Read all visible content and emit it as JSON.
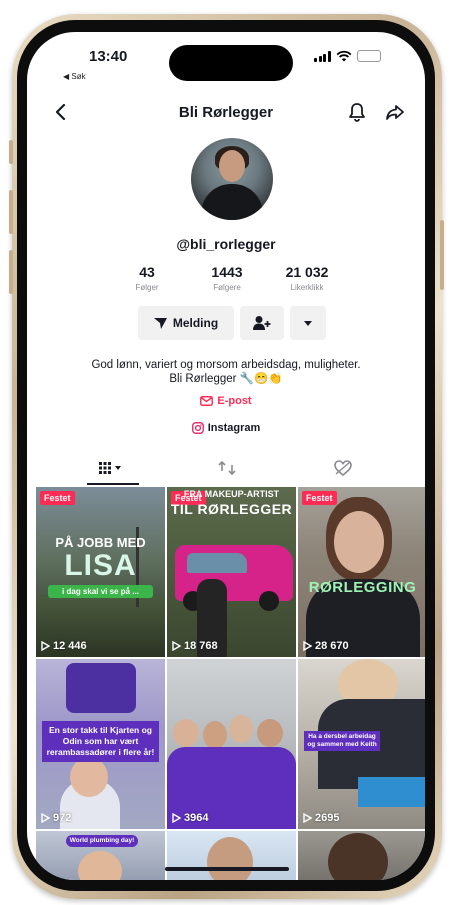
{
  "status_bar": {
    "time": "13:40",
    "back_label": "◀ Søk"
  },
  "header": {
    "title": "Bli Rørlegger"
  },
  "profile": {
    "handle": "@bli_rorlegger",
    "stats": [
      {
        "value": "43",
        "label": "Følger"
      },
      {
        "value": "1443",
        "label": "Følgere"
      },
      {
        "value": "21 032",
        "label": "Likerklikk"
      }
    ],
    "message_button": "Melding",
    "bio_line1": "God lønn, variert og morsom arbeidsdag, muligheter.",
    "bio_line2": "Bli Rørlegger 🔧😁👏",
    "email_link": "E-post",
    "instagram_link": "Instagram"
  },
  "videos": [
    {
      "pinned": "Festet",
      "caption": "PÅ JOBB MED",
      "caption2": "LISA",
      "caption3": "i dag skal vi se på ...",
      "views": "12 446"
    },
    {
      "pinned": "Festet",
      "caption": "FRA MAKEUP-ARTIST",
      "caption2": "TIL RØRLEGGER",
      "views": "18 768"
    },
    {
      "pinned": "Festet",
      "caption": "RØRLEGGING",
      "views": "28 670"
    },
    {
      "caption": "En stor takk til Kjarten og Odin som har vært rerambassadører i flere år!",
      "views": "972"
    },
    {
      "caption": "",
      "views": "3964"
    },
    {
      "caption": "Ha a dersbel arbeidag og sammen med Keith",
      "views": "2695"
    },
    {
      "caption": "World plumbing day!"
    },
    {
      "caption": ""
    },
    {
      "caption": ""
    }
  ],
  "colors": {
    "accent": "#fe2c55",
    "purple": "#5e2fbd",
    "text": "#161823",
    "muted": "#8a8b91"
  }
}
